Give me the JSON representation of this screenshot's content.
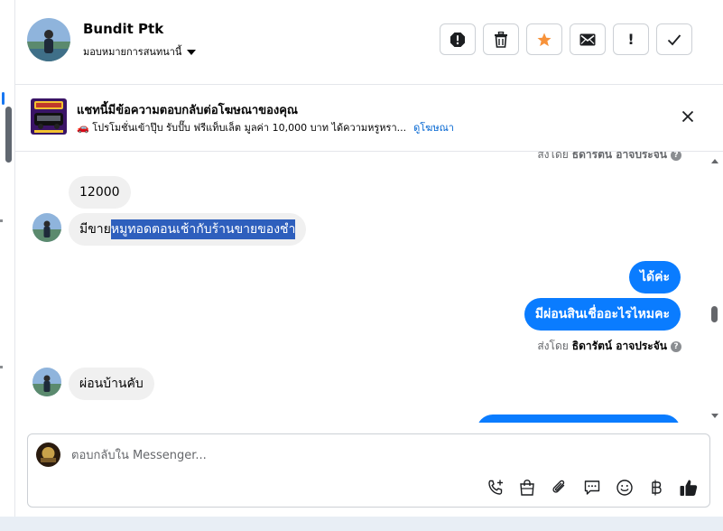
{
  "header": {
    "contact_name": "Bundit Ptk",
    "assign_label": "มอบหมายการสนทนานี้",
    "buttons": [
      {
        "name": "mark-spam-button",
        "icon": "alert-octagon-icon"
      },
      {
        "name": "delete-button",
        "icon": "trash-icon"
      },
      {
        "name": "star-button",
        "icon": "star-icon"
      },
      {
        "name": "mark-unread-button",
        "icon": "envelope-icon"
      },
      {
        "name": "follow-up-button",
        "icon": "exclamation-icon",
        "label": "!"
      },
      {
        "name": "mark-done-button",
        "icon": "checkmark-icon"
      }
    ]
  },
  "banner": {
    "title": "แชทนี้มีข้อความตอบกลับต่อโฆษณาของคุณ",
    "description": "🚗 โปรโมชั่นเข้าปุ๊บ รับปั๊บ ฟรีแท็บเล็ต มูลค่า 10,000 บาท ได้ความหรูหรา...",
    "link_label": "ดูโฆษณา"
  },
  "messages": {
    "clipped_sender": {
      "prefix": "ส่งโดย",
      "name": "ธิดารัตน์ อาจประจัน"
    },
    "msg1": "12000",
    "msg2_plain": "มีขาย",
    "msg2_highlight": "หมูทอดตอนเช้ากับร้านขายของชำ",
    "msg3": "ได้ค่ะ",
    "msg4": "มีผ่อนสินเชื่ออะไรไหมคะ",
    "sender": {
      "prefix": "ส่งโดย",
      "name": "ธิดารัตน์ อาจประจัน"
    },
    "msg5": "ผ่อนบ้านคับ"
  },
  "composer": {
    "placeholder": "ตอบกลับใน Messenger..."
  },
  "colors": {
    "outgoing_bubble": "#0a7cff",
    "incoming_bubble": "#f0f0f0",
    "link": "#0064d1",
    "star": "#f7923a",
    "highlight": "#2e5fbd"
  }
}
